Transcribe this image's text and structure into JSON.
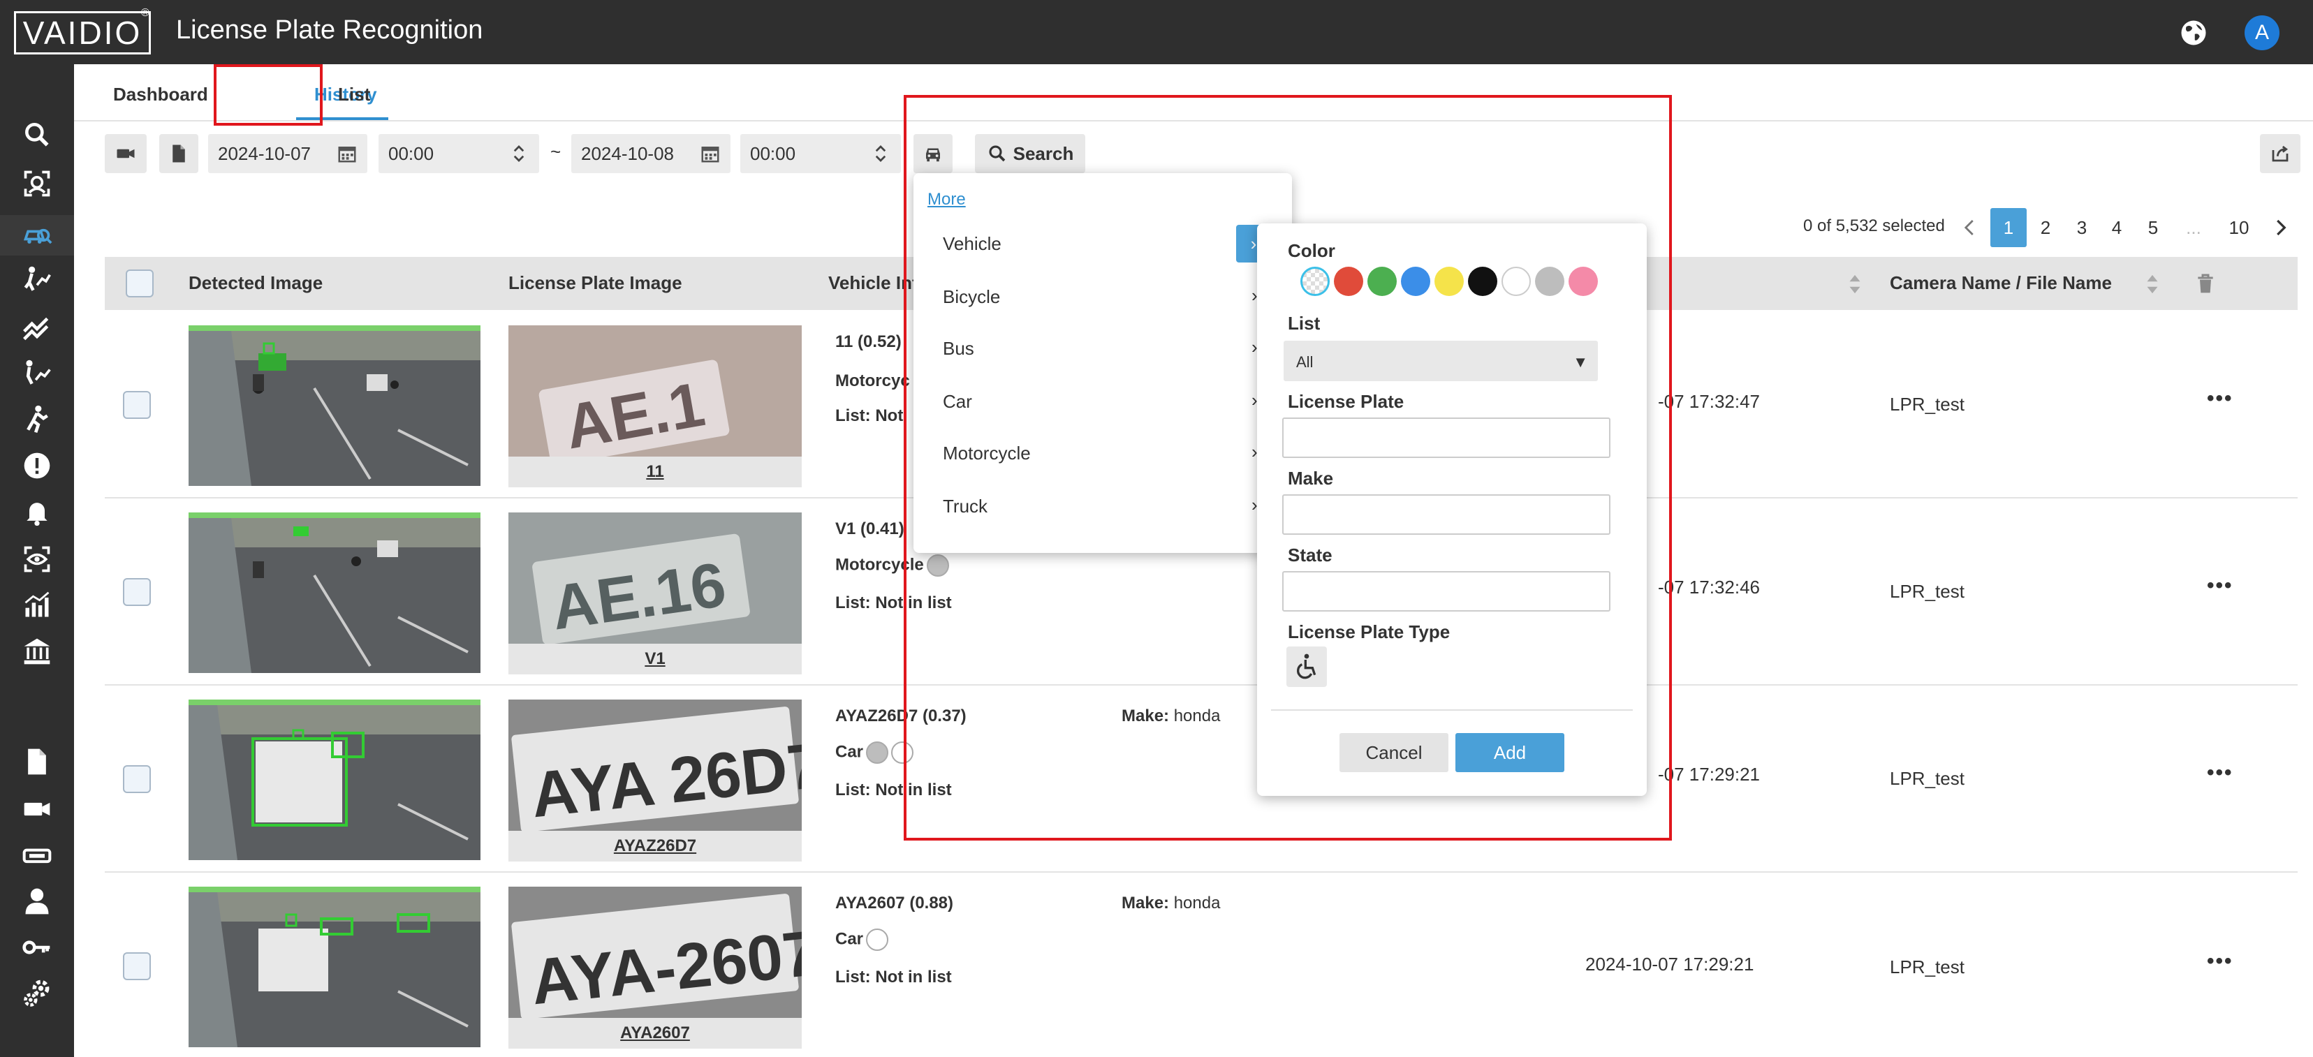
{
  "app": {
    "logo_text": "VAIDIO",
    "logo_reg": "®",
    "title": "License Plate Recognition",
    "user_initial": "A"
  },
  "sidebar": {
    "icons": [
      "search-icon",
      "face-scan-icon",
      "car-search-icon",
      "person-track-icon",
      "trend-icon",
      "path-icon",
      "running-icon",
      "alert-icon",
      "bell-icon",
      "eye-icon",
      "analytics-icon",
      "bank-icon",
      "file-icon",
      "camera-icon",
      "device-icon",
      "user-icon",
      "key-icon",
      "settings-icon"
    ]
  },
  "tabs": [
    {
      "label": "Dashboard",
      "active": false
    },
    {
      "label": "History",
      "active": true
    },
    {
      "label": "List",
      "active": false
    }
  ],
  "toolbar": {
    "date_from": "2024-10-07",
    "time_from": "00:00",
    "separator": "~",
    "date_to": "2024-10-08",
    "time_to": "00:00",
    "search_label": "Search"
  },
  "pagination": {
    "selected_text": "0 of 5,532 selected",
    "pages": [
      "1",
      "2",
      "3",
      "4",
      "5",
      "...",
      "10"
    ],
    "active_page": "1"
  },
  "table": {
    "headers": {
      "detected": "Detected Image",
      "plate": "License Plate Image",
      "vehicle": "Vehicle Inf",
      "camera": "Camera Name / File Name"
    },
    "rows": [
      {
        "plate_text": "11",
        "line1": "11 (0.52)",
        "line2": "Motorcyc",
        "line3": "List: Not",
        "make": "",
        "time": "-07 17:32:47",
        "camera": "LPR_test"
      },
      {
        "plate_text": "V1",
        "line1": "V1 (0.41)",
        "line2": "Motorcycle",
        "line3": "List: Not in list",
        "make": "",
        "time": "-07 17:32:46",
        "camera": "LPR_test"
      },
      {
        "plate_text": "AYAZ26D7",
        "line1": "AYAZ26D7 (0.37)",
        "line2": "Car",
        "line3": "List: Not in list",
        "make_label": "Make:",
        "make": "honda",
        "time": "-07 17:29:21",
        "camera": "LPR_test"
      },
      {
        "plate_text": "AYA2607",
        "line1": "AYA2607 (0.88)",
        "line2": "Car",
        "line3": "List: Not in list",
        "make_label": "Make:",
        "make": "honda",
        "time": "2024-10-07 17:29:21",
        "camera": "LPR_test"
      }
    ]
  },
  "more_menu": {
    "link": "More",
    "items": [
      "Vehicle",
      "Bicycle",
      "Bus",
      "Car",
      "Motorcycle",
      "Truck"
    ]
  },
  "filter_panel": {
    "color_label": "Color",
    "colors": [
      "#e0e0e0",
      "#e04b3a",
      "#4caf50",
      "#3b8ee8",
      "#f5e34a",
      "#111111",
      "#ffffff",
      "#bdbdbd",
      "#f48aa8"
    ],
    "list_label": "List",
    "list_value": "All",
    "plate_label": "License Plate",
    "make_label": "Make",
    "state_label": "State",
    "type_label": "License Plate Type",
    "cancel_label": "Cancel",
    "add_label": "Add"
  },
  "colors": {
    "accent": "#4aa0d8",
    "highlight": "#e0171d",
    "dark_bar": "#2f2f2f"
  }
}
